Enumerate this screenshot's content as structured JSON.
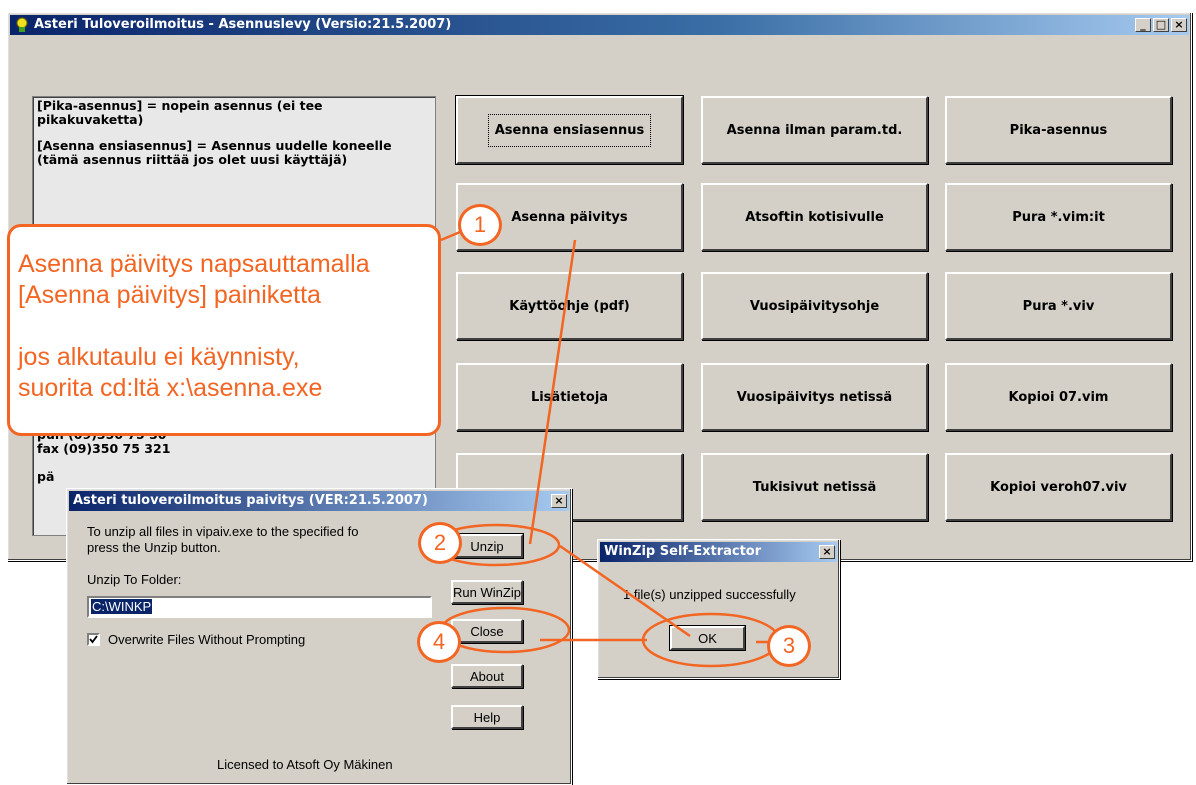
{
  "main_window": {
    "title": "Asteri Tuloveroilmoitus - Asennuslevy (Versio:21.5.2007)",
    "controls": {
      "minimize": "_",
      "maximize": "□",
      "close": "×"
    },
    "info_text": [
      "[Pika-asennus] = nopein asennus (ei tee pikakuvaketta)",
      "[Asenna ensiasennus] = Asennus uudelle koneelle (tämä asennus riittää jos olet uusi käyttäjä)",
      "puh (09)350 75 30",
      "fax (09)350 75 321",
      "pä"
    ],
    "buttons": [
      "Asenna ensiasennus",
      "Asenna ilman param.td.",
      "Pika-asennus",
      "Asenna päivitys",
      "Atsoftin kotisivulle",
      "Pura *.vim:it",
      "Käyttöohje (pdf)",
      "Vuosipäivitysohje",
      "Pura *.viv",
      "Lisätietoja",
      "Vuosipäivitys netissä",
      "Kopioi 07.vim",
      "",
      "Tukisivut netissä",
      "Kopioi veroh07.viv"
    ]
  },
  "callout": {
    "lines": [
      "Asenna päivitys napsauttamalla",
      "[Asenna päivitys] painiketta",
      "",
      "jos alkutaulu ei käynnisty,",
      "suorita cd:ltä x:\\asenna.exe"
    ]
  },
  "step_numbers": [
    "1",
    "2",
    "3",
    "4"
  ],
  "unzip_dialog": {
    "title": "Asteri tuloveroilmoitus paivitys (VER:21.5.2007)",
    "close": "×",
    "description_line1": "To unzip all files in vipaiv.exe to the specified fo",
    "description_line2": "press the Unzip button.",
    "folder_label": "Unzip To Folder:",
    "folder_value": "C:\\WINKP",
    "overwrite_label": "Overwrite Files Without Prompting",
    "overwrite_checked": true,
    "buttons": {
      "unzip": "Unzip",
      "run_winzip": "Run WinZip",
      "close": "Close",
      "about": "About",
      "help": "Help"
    },
    "license": "Licensed to Atsoft Oy Mäkinen"
  },
  "winzip_dialog": {
    "title": "WinZip Self-Extractor",
    "close": "×",
    "message": "1 file(s) unzipped successfully",
    "ok": "OK"
  },
  "colors": {
    "accent_orange": "#f26522",
    "title_blue": "#0a246a",
    "face": "#d4d0c8"
  }
}
